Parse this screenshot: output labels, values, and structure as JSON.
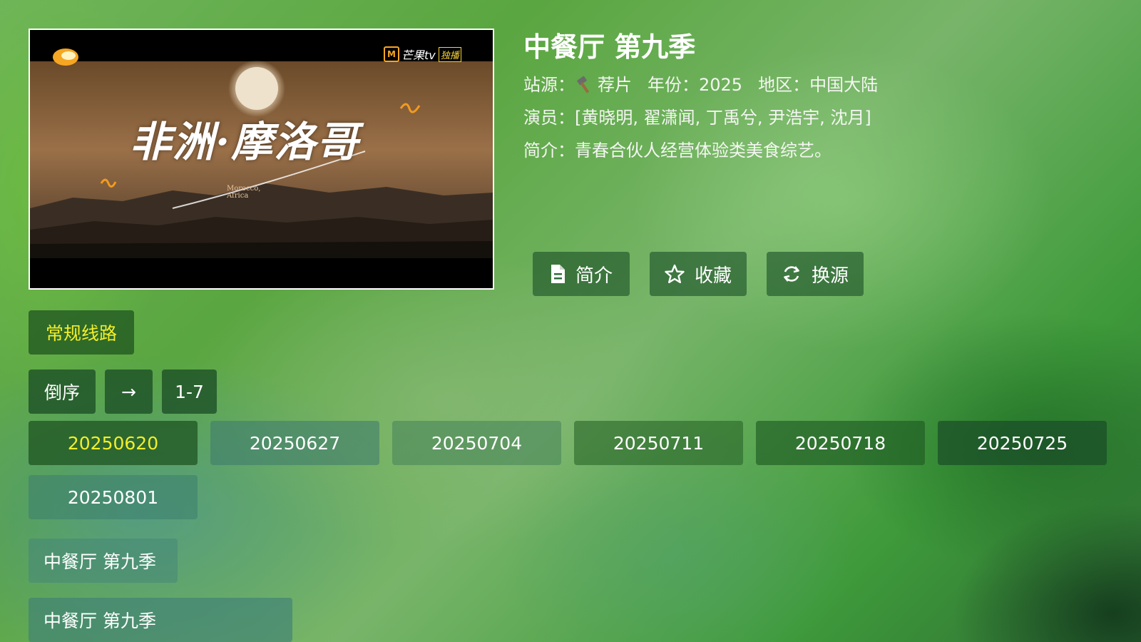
{
  "show": {
    "title": "中餐厅 第九季",
    "source_label": "站源：",
    "source_icon": "hammer-icon",
    "source_value": "荐片",
    "year_label": "年份：",
    "year_value": "2025",
    "region_label": "地区：",
    "region_value": "中国大陆",
    "cast_label": "演员：",
    "cast_value": "[黄晓明, 翟潇闻, 丁禹兮, 尹浩宇, 沈月]",
    "intro_label": "简介：",
    "intro_value": "青春合伙人经营体验类美食综艺。"
  },
  "poster": {
    "title_text": "非洲·摩洛哥",
    "subtitle_text": "Morocco, Africa",
    "logo_text": "芒果tv",
    "badge_text": "独播",
    "brand_mark": "M"
  },
  "actions": [
    {
      "label": "简介",
      "icon": "document-icon"
    },
    {
      "label": "收藏",
      "icon": "star-icon"
    },
    {
      "label": "换源",
      "icon": "refresh-icon"
    }
  ],
  "route": {
    "label": "常规线路"
  },
  "controls": {
    "sort_label": "倒序",
    "arrow_label": "→",
    "range_label": "1-7"
  },
  "episodes": [
    "20250620",
    "20250627",
    "20250704",
    "20250711",
    "20250718",
    "20250725",
    "20250801"
  ],
  "selected_episode": "20250620",
  "related": [
    "中餐厅 第九季",
    "中餐厅 第九季"
  ],
  "colors": {
    "selected_text": "#f2ee2a",
    "accent_logo": "#f5a623"
  }
}
